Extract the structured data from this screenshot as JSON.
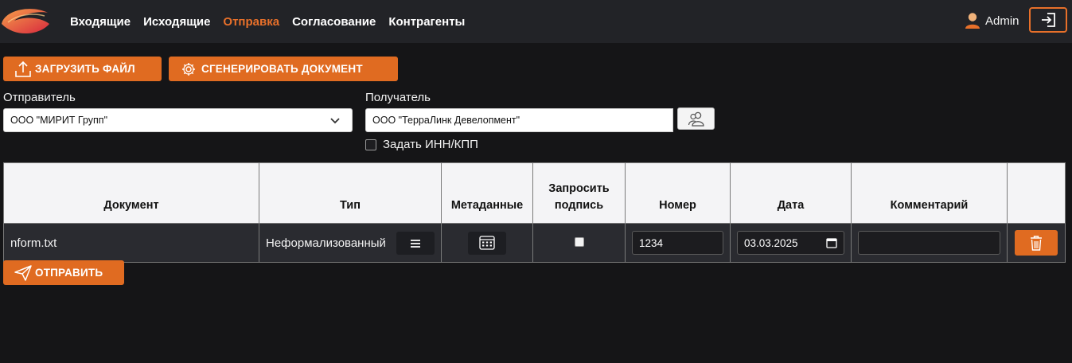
{
  "nav": {
    "items": [
      {
        "label": "Входящие",
        "active": false
      },
      {
        "label": "Исходящие",
        "active": false
      },
      {
        "label": "Отправка",
        "active": true
      },
      {
        "label": "Согласование",
        "active": false
      },
      {
        "label": "Контрагенты",
        "active": false
      }
    ],
    "user": "Admin",
    "logout_icon": "logout-icon"
  },
  "toolbar": {
    "upload_label": "ЗАГРУЗИТЬ ФАЙЛ",
    "generate_label": "СГЕНЕРИРОВАТЬ ДОКУМЕНТ"
  },
  "form": {
    "sender_label": "Отправитель",
    "sender_value": "ООО \"МИРИТ Групп\"",
    "recipient_label": "Получатель",
    "recipient_value": "ООО \"ТерраЛинк Девелопмент\"",
    "inn_kpp_label": "Задать ИНН/КПП",
    "inn_kpp_checked": false
  },
  "table": {
    "headers": [
      "Документ",
      "Тип",
      "Метаданные",
      "Запросить подпись",
      "Номер",
      "Дата",
      "Комментарий",
      ""
    ],
    "rows": [
      {
        "document": "nform.txt",
        "type": "Неформализованный",
        "request_signature": false,
        "number": "1234",
        "date": "03.03.2025",
        "comment": ""
      }
    ]
  },
  "send_label": "ОТПРАВИТЬ",
  "colors": {
    "accent": "#e06b21",
    "background": "#151517",
    "topbar": "#222327"
  }
}
